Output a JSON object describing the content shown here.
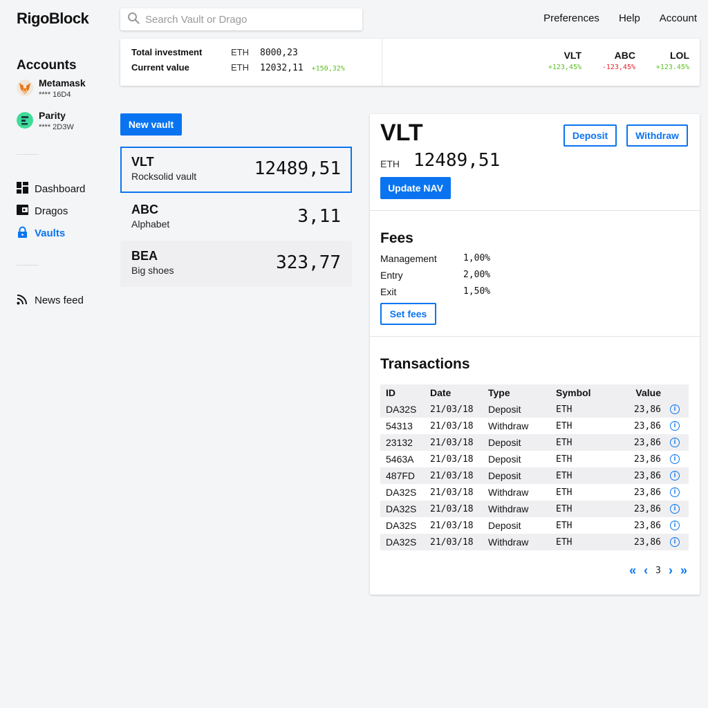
{
  "app": {
    "logo": "RigoBlock"
  },
  "search": {
    "placeholder": "Search Vault or Drago"
  },
  "topnav": [
    "Preferences",
    "Help",
    "Account"
  ],
  "sidebar": {
    "accounts_heading": "Accounts",
    "accounts": [
      {
        "name": "Metamask",
        "number": "**** 16D4",
        "icon": "metamask-fox-icon"
      },
      {
        "name": "Parity",
        "number": "**** 2D3W",
        "icon": "parity-icon"
      }
    ],
    "nav": [
      {
        "label": "Dashboard",
        "icon": "dashboard-icon"
      },
      {
        "label": "Dragos",
        "icon": "wallet-icon"
      },
      {
        "label": "Vaults",
        "icon": "lock-icon",
        "active": true
      }
    ],
    "feed": {
      "label": "News feed",
      "icon": "rss-icon"
    }
  },
  "summary": {
    "total_investment_label": "Total investment",
    "total_investment_currency": "ETH",
    "total_investment_value": "8000,23",
    "current_value_label": "Current value",
    "current_value_currency": "ETH",
    "current_value_value": "12032,11",
    "current_value_change": "+150,32%",
    "tickers": [
      {
        "symbol": "VLT",
        "change": "+123,45%",
        "direction": "up"
      },
      {
        "symbol": "ABC",
        "change": "-123,45%",
        "direction": "down"
      },
      {
        "symbol": "LOL",
        "change": "+123.45%",
        "direction": "up"
      }
    ]
  },
  "vaults": {
    "new_button": "New vault",
    "items": [
      {
        "code": "VLT",
        "name": "Rocksolid vault",
        "amount": "12489,51",
        "selected": true
      },
      {
        "code": "ABC",
        "name": "Alphabet",
        "amount": "3,11"
      },
      {
        "code": "BEA",
        "name": "Big shoes",
        "amount": "323,77"
      }
    ]
  },
  "detail": {
    "title": "VLT",
    "currency": "ETH",
    "value": "12489,51",
    "deposit_button": "Deposit",
    "withdraw_button": "Withdraw",
    "update_nav_button": "Update NAV",
    "fees": {
      "heading": "Fees",
      "items": [
        {
          "label": "Management",
          "value": "1,00%"
        },
        {
          "label": "Entry",
          "value": "2,00%"
        },
        {
          "label": "Exit",
          "value": "1,50%"
        }
      ],
      "set_button": "Set fees"
    },
    "transactions": {
      "heading": "Transactions",
      "columns": [
        "ID",
        "Date",
        "Type",
        "Symbol",
        "Value"
      ],
      "rows": [
        [
          "DA32S",
          "21/03/18",
          "Deposit",
          "ETH",
          "23,86"
        ],
        [
          "54313",
          "21/03/18",
          "Withdraw",
          "ETH",
          "23,86"
        ],
        [
          "23132",
          "21/03/18",
          "Deposit",
          "ETH",
          "23,86"
        ],
        [
          "5463A",
          "21/03/18",
          "Deposit",
          "ETH",
          "23,86"
        ],
        [
          "487FD",
          "21/03/18",
          "Deposit",
          "ETH",
          "23,86"
        ],
        [
          "DA32S",
          "21/03/18",
          "Withdraw",
          "ETH",
          "23,86"
        ],
        [
          "DA32S",
          "21/03/18",
          "Withdraw",
          "ETH",
          "23,86"
        ],
        [
          "DA32S",
          "21/03/18",
          "Deposit",
          "ETH",
          "23,86"
        ],
        [
          "DA32S",
          "21/03/18",
          "Withdraw",
          "ETH",
          "23,86"
        ]
      ],
      "info_glyph": "i",
      "pager": {
        "first": "«",
        "prev": "‹",
        "page": "3",
        "next": "›",
        "last": "»"
      }
    }
  },
  "colors": {
    "accent": "#0a74f0",
    "positive": "#5bbf21",
    "negative": "#e8202c",
    "background": "#f4f5f7"
  }
}
